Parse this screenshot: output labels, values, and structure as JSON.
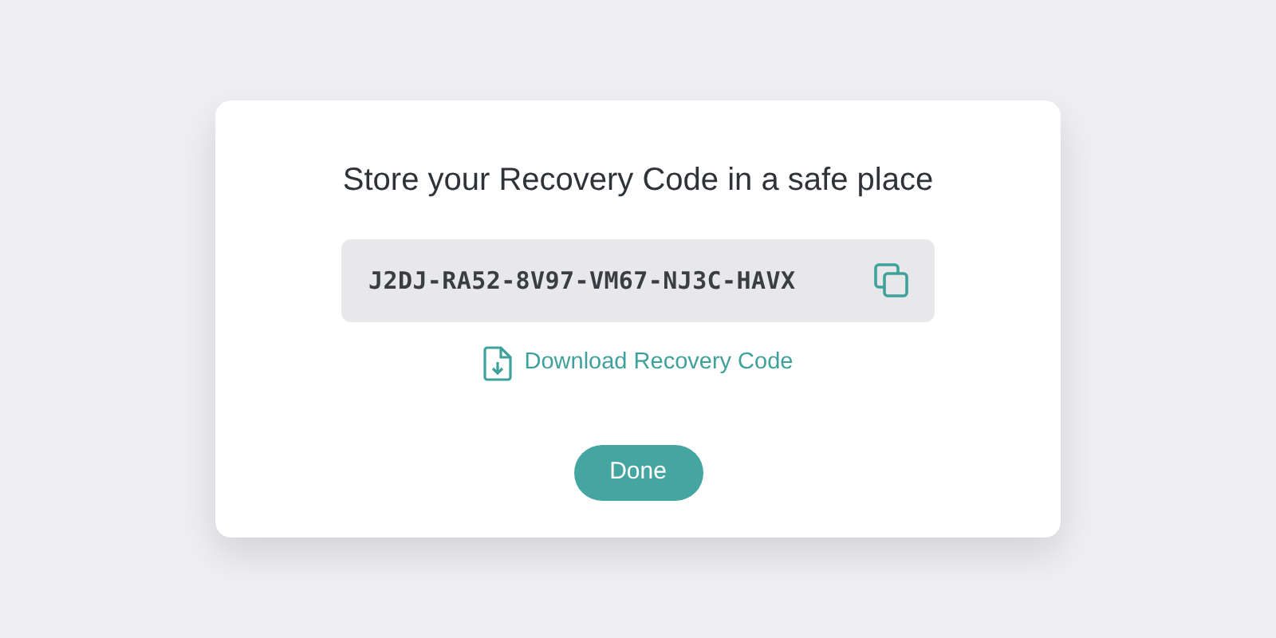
{
  "dialog": {
    "title": "Store your Recovery Code in a safe place",
    "code": "J2DJ-RA52-8V97-VM67-NJ3C-HAVX",
    "download_link": "Download Recovery Code",
    "buttons": [
      "Done"
    ]
  }
}
